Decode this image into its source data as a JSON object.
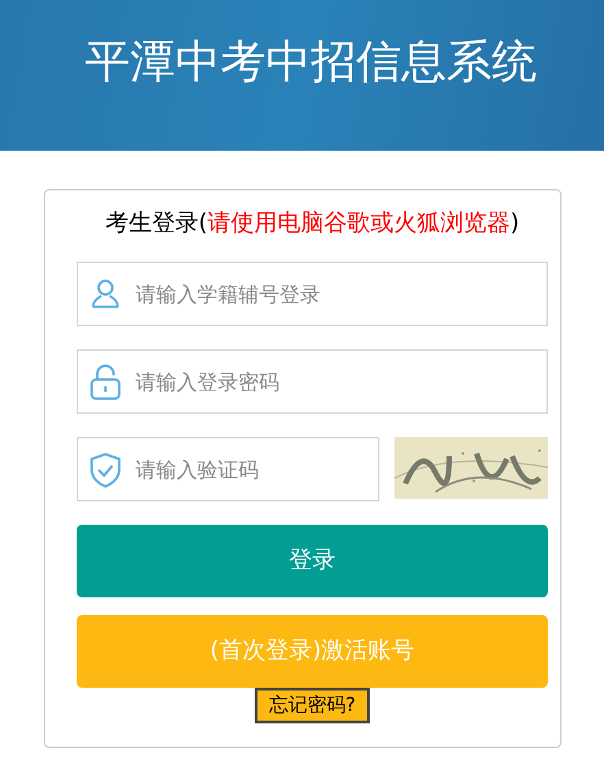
{
  "header": {
    "title": "平潭中考中招信息系统"
  },
  "login": {
    "heading": {
      "prefix": "考生登录(",
      "notice": "请使用电脑谷歌或火狐浏览器",
      "suffix": ")"
    },
    "fields": [
      {
        "kind": "user",
        "placeholder": "请输入学籍辅号登录"
      },
      {
        "kind": "lock",
        "placeholder": "请输入登录密码"
      },
      {
        "kind": "shield",
        "placeholder": "请输入验证码"
      }
    ],
    "buttons": [
      {
        "kind": "primary",
        "label": "登录"
      },
      {
        "kind": "activate",
        "label": "(首次登录)激活账号"
      }
    ],
    "forgot": "忘记密码?"
  }
}
